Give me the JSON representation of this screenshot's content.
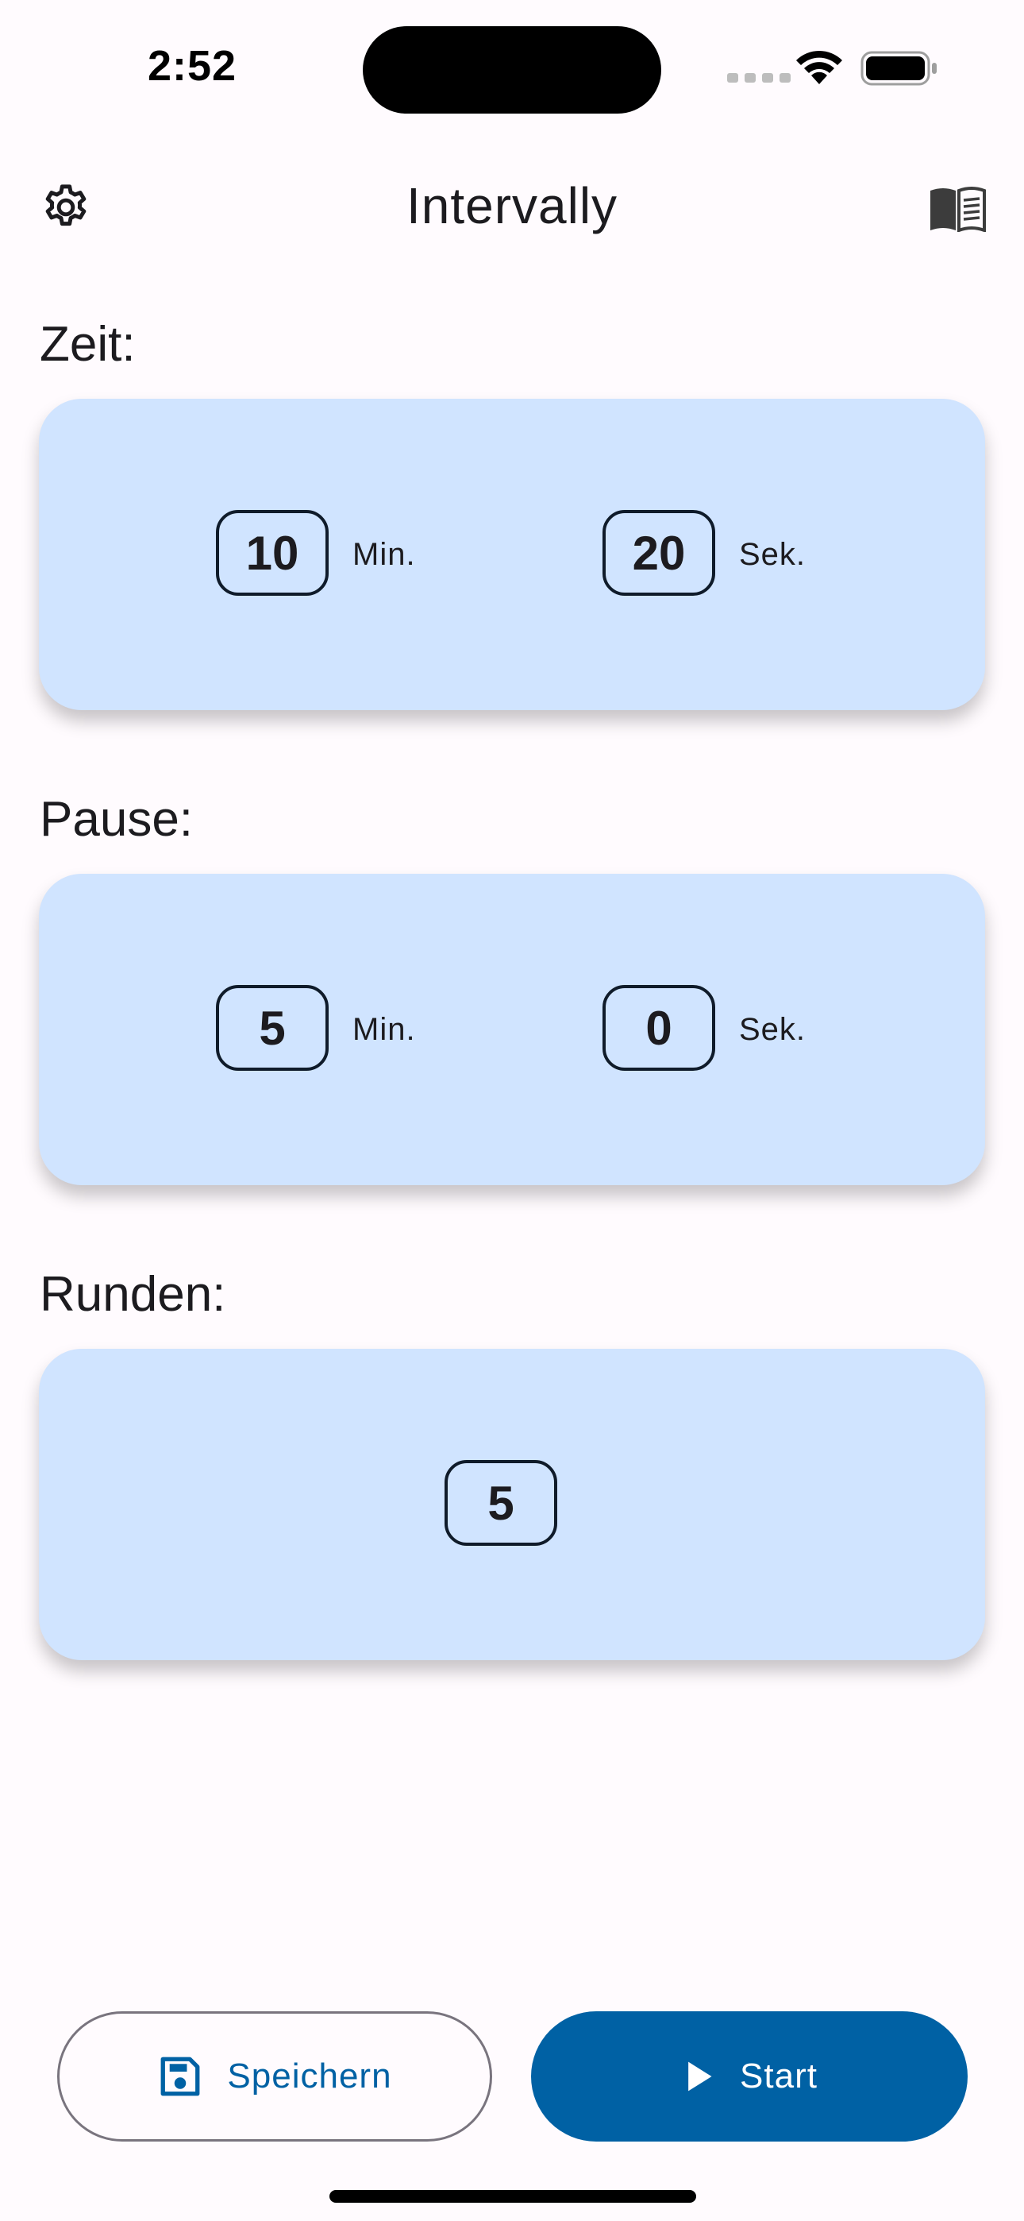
{
  "status_bar": {
    "time": "2:52"
  },
  "app_bar": {
    "title": "Intervally",
    "left_icon": "gear-icon",
    "right_icon": "book-icon"
  },
  "sections": {
    "zeit": {
      "label": "Zeit:",
      "minutes": "10",
      "minutes_unit": "Min.",
      "seconds": "20",
      "seconds_unit": "Sek."
    },
    "pause": {
      "label": "Pause:",
      "minutes": "5",
      "minutes_unit": "Min.",
      "seconds": "0",
      "seconds_unit": "Sek."
    },
    "runden": {
      "label": "Runden:",
      "count": "5"
    }
  },
  "buttons": {
    "save_label": "Speichern",
    "save_icon": "save-icon",
    "start_label": "Start",
    "start_icon": "play-icon"
  },
  "colors": {
    "background": "#FFFBFE",
    "card": "#D0E4FF",
    "primary": "#0061A4",
    "outline": "#79747E"
  }
}
